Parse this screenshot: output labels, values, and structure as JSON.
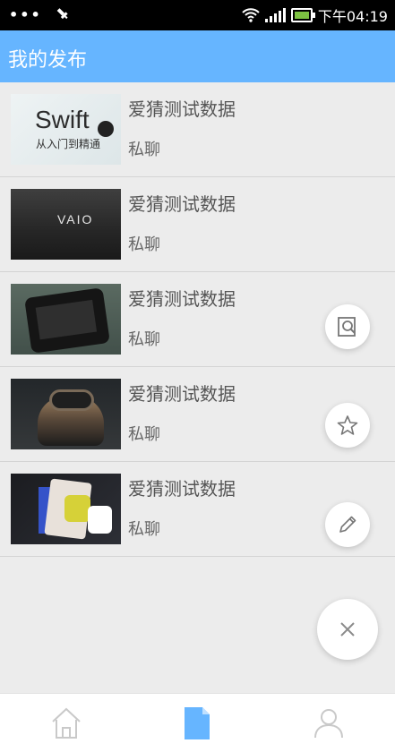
{
  "status": {
    "dots": "•••",
    "time": "下午04:19"
  },
  "header": {
    "title": "我的发布"
  },
  "items": [
    {
      "title": "爱猜测试数据",
      "subtitle": "私聊"
    },
    {
      "title": "爱猜测试数据",
      "subtitle": "私聊"
    },
    {
      "title": "爱猜测试数据",
      "subtitle": "私聊"
    },
    {
      "title": "爱猜测试数据",
      "subtitle": "私聊"
    },
    {
      "title": "爱猜测试数据",
      "subtitle": "私聊"
    }
  ],
  "thumbnails": {
    "swift": {
      "word": "Swift",
      "subtitle": "从入门到精通"
    },
    "laptop": {
      "brand": "VAIO"
    }
  },
  "fab": {
    "search_icon": "search-document-icon",
    "favorite_icon": "star-icon",
    "edit_icon": "pencil-icon",
    "close_icon": "close-icon"
  },
  "nav": {
    "home_icon": "home-icon",
    "doc_icon": "document-icon",
    "user_icon": "user-icon",
    "active_color": "#66b5ff"
  }
}
